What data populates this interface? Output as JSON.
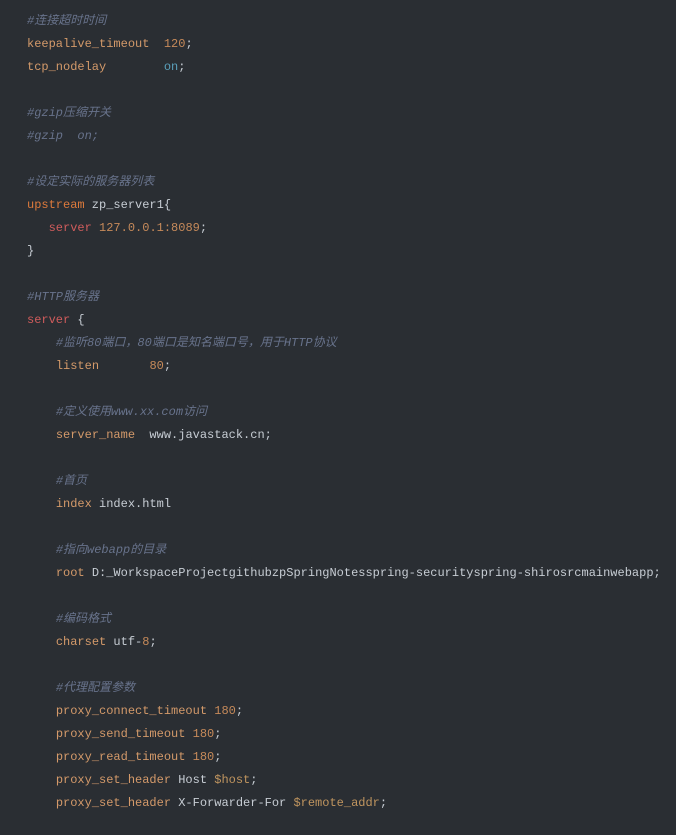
{
  "comments": {
    "c1": "#连接超时时间",
    "c2": "#gzip压缩开关",
    "c3": "#gzip  on;",
    "c4": "#设定实际的服务器列表",
    "c5": "#HTTP服务器",
    "c6": "#监听80端口，80端口是知名端口号，用于HTTP协议",
    "c7": "#定义使用www.xx.com访问",
    "c8": "#首页",
    "c9": "#指向webapp的目录",
    "c10": "#编码格式",
    "c11": "#代理配置参数"
  },
  "directives": {
    "keepalive_timeout": "keepalive_timeout",
    "tcp_nodelay": "tcp_nodelay",
    "upstream": "upstream",
    "server": "server",
    "listen": "listen",
    "server_name": "server_name",
    "index": "index",
    "root": "root",
    "charset": "charset",
    "proxy_connect_timeout": "proxy_connect_timeout",
    "proxy_send_timeout": "proxy_send_timeout",
    "proxy_read_timeout": "proxy_read_timeout",
    "proxy_set_header": "proxy_set_header"
  },
  "values": {
    "keepalive_timeout": "120",
    "tcp_nodelay": "on",
    "upstream_name": " zp_server1{",
    "upstream_server": "127.0.0.1:8089",
    "server_brace": " {",
    "listen": "80",
    "server_name": "  www.javastack.cn",
    "index": " index.html",
    "root": " D:_WorkspaceProjectgithubzpSpringNotesspring-securityspring-shirosrcmainwebapp",
    "charset_prefix": " utf-",
    "charset_num": "8",
    "pct": "180",
    "pst": "180",
    "prt": "180",
    "host_literal": " Host ",
    "host_var": "$host",
    "xfwd_literal": " X-Forwarder-For ",
    "xfwd_var": "$remote_addr"
  },
  "punct": {
    "semi": ";",
    "close_brace": "}"
  }
}
